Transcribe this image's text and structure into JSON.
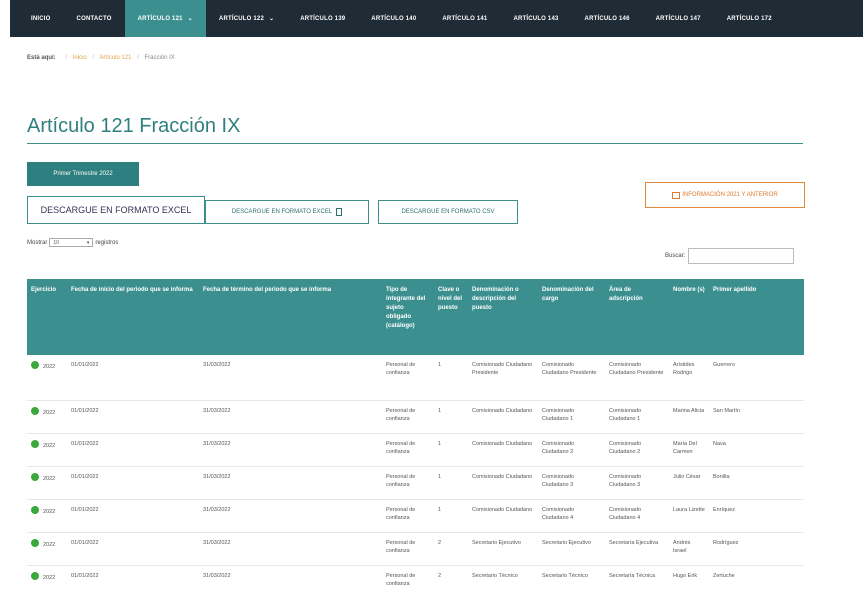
{
  "nav": {
    "items": [
      {
        "label": "INICIO",
        "active": false,
        "caret": false
      },
      {
        "label": "CONTACTO",
        "active": false,
        "caret": false
      },
      {
        "label": "ARTÍCULO 121",
        "active": true,
        "caret": true
      },
      {
        "label": "ARTÍCULO 122",
        "active": false,
        "caret": true
      },
      {
        "label": "ARTÍCULO 139",
        "active": false,
        "caret": false
      },
      {
        "label": "ARTÍCULO 140",
        "active": false,
        "caret": false
      },
      {
        "label": "ARTÍCULO 141",
        "active": false,
        "caret": false
      },
      {
        "label": "ARTÍCULO 143",
        "active": false,
        "caret": false
      },
      {
        "label": "ARTÍCULO 146",
        "active": false,
        "caret": false
      },
      {
        "label": "ARTÍCULO 147",
        "active": false,
        "caret": false
      },
      {
        "label": "ARTÍCULO 172",
        "active": false,
        "caret": false
      }
    ]
  },
  "breadcrumb": {
    "here_label": "Está aquí:",
    "items": [
      "Inicio",
      "Artículo 121",
      "Fracción IX"
    ]
  },
  "page": {
    "title": "Artículo 121 Fracción IX"
  },
  "tabs": {
    "active": "Primer Trimestre 2022"
  },
  "buttons": {
    "excel_main": "DESCARGUE EN FORMATO EXCEL",
    "excel_alt": "DESCARGUE EN FORMATO EXCEL",
    "csv": "DESCARGUE EN FORMATO CSV",
    "info": "INFORMACIÓN 2021 Y ANTERIOR"
  },
  "length": {
    "prefix": "Mostrar",
    "value": "10",
    "suffix": "registros"
  },
  "search": {
    "label": "Buscar:",
    "value": ""
  },
  "table": {
    "headers": [
      "Ejercicio",
      "Fecha de inicio del periodo que se informa",
      "Fecha de término del periodo que se informa",
      "Tipo de integrante del sujeto obligado (catálogo)",
      "Clave o nivel del puesto",
      "Denominación o descripción del puesto",
      "Denominación del cargo",
      "Área de adscripción",
      "Nombre (s)",
      "Primer apellido"
    ],
    "rows": [
      [
        "2022",
        "01/01/2022",
        "31/03/2022",
        "Personal de confianza",
        "1",
        "Comisionado Ciudadano Presidente",
        "Comisionado Ciudadano Presidente",
        "Comisionado Ciudadano Presidente",
        "Arístides Rodrigo",
        "Guerrero"
      ],
      [
        "2022",
        "01/01/2022",
        "31/03/2022",
        "Personal de confianza",
        "1",
        "Comisionado Ciudadano",
        "Comisionado Ciudadano 1",
        "Comisionado Ciudadano 1",
        "Marina Alicia",
        "San Martín"
      ],
      [
        "2022",
        "01/01/2022",
        "31/03/2022",
        "Personal de confianza",
        "1",
        "Comisionado Ciudadano",
        "Comisionado Ciudadano 2",
        "Comisionado Ciudadano 2",
        "María Del Carmen",
        "Nava"
      ],
      [
        "2022",
        "01/01/2022",
        "31/03/2022",
        "Personal de confianza",
        "1",
        "Comisionado Ciudadano",
        "Comisionado Ciudadano 3",
        "Comisionado Ciudadano 3",
        "Julio César",
        "Bonilla"
      ],
      [
        "2022",
        "01/01/2022",
        "31/03/2022",
        "Personal de confianza",
        "1",
        "Comisionado Ciudadano",
        "Comisionado Ciudadano 4",
        "Comisionado Ciudadano 4",
        "Laura Lizette",
        "Enríquez"
      ],
      [
        "2022",
        "01/01/2022",
        "31/03/2022",
        "Personal de confianza",
        "2",
        "Secretario Ejecutivo",
        "Secretario Ejecutivo",
        "Secretaría Ejecutiva",
        "Andrés Israel",
        "Rodríguez"
      ],
      [
        "2022",
        "01/01/2022",
        "31/03/2022",
        "Personal de confianza",
        "2",
        "Secretario Técnico",
        "Secretario Técnico",
        "Secretaría Técnica",
        "Hugo Erik",
        "Zertuche"
      ]
    ]
  },
  "colors": {
    "nav_bg": "#1f2b35",
    "accent": "#3c8f8f",
    "link": "#e3a44c",
    "info_border": "#e08a3c",
    "status_dot": "#3aa83a"
  }
}
